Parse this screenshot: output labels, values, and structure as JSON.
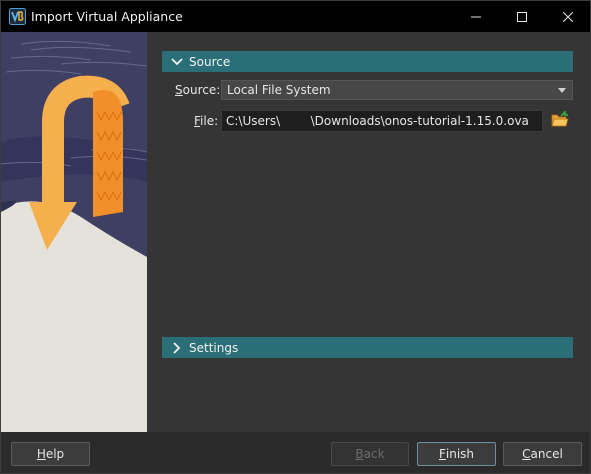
{
  "window": {
    "title": "Import Virtual Appliance"
  },
  "source_section": {
    "header": "Source",
    "source_label_mnemonic": "S",
    "source_label_rest": "ource:",
    "source_value": "Local File System",
    "file_label_mnemonic": "F",
    "file_label_rest": "ile:",
    "file_value": "C:\\Users\\        \\Downloads\\onos-tutorial-1.15.0.ova"
  },
  "settings_section": {
    "header": "Settings"
  },
  "buttons": {
    "help_mnemonic": "H",
    "help_rest": "elp",
    "back_mnemonic": "B",
    "back_rest": "ack",
    "finish_mnemonic": "F",
    "finish_rest": "inish",
    "cancel_mnemonic": "C",
    "cancel_rest": "ancel"
  },
  "icons": {
    "app": "virtualbox-icon",
    "minimize": "minimize-icon",
    "maximize": "maximize-icon",
    "close": "close-icon",
    "source_expanded": "chevron-down-icon",
    "settings_collapsed": "chevron-right-icon",
    "combo_arrow": "dropdown-arrow-icon",
    "folder": "open-folder-icon"
  },
  "colors": {
    "section_header": "#2a6e77",
    "titlebar": "#000000",
    "background": "#353535"
  }
}
